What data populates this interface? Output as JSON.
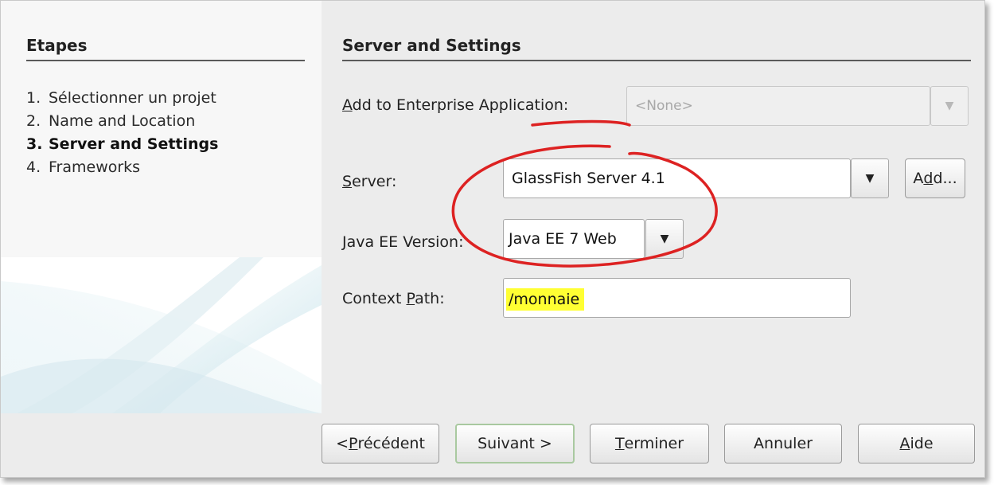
{
  "steps": {
    "title": "Etapes",
    "items": [
      {
        "num": "1.",
        "label": "Sélectionner un projet"
      },
      {
        "num": "2.",
        "label": "Name and Location"
      },
      {
        "num": "3.",
        "label": "Server and Settings"
      },
      {
        "num": "4.",
        "label": "Frameworks"
      }
    ],
    "current_index": 2
  },
  "panel": {
    "title": "Server and Settings",
    "enterprise": {
      "label_pre": "",
      "label_mn": "A",
      "label_post": "dd to Enterprise Application:",
      "value": "<None>",
      "enabled": false
    },
    "server": {
      "label_pre": "",
      "label_mn": "S",
      "label_post": "erver:",
      "value": "GlassFish Server 4.1",
      "add_pre": "A",
      "add_mn": "d",
      "add_post": "d..."
    },
    "java_ee": {
      "label_pre": "",
      "label_mn": "J",
      "label_post": "ava EE Version:",
      "value": "Java EE 7 Web"
    },
    "context": {
      "label_pre": "Context ",
      "label_mn": "P",
      "label_post": "ath:",
      "value": "/monnaie"
    }
  },
  "footer": {
    "prev": {
      "pre": "< ",
      "mn": "P",
      "post": "récédent"
    },
    "next": {
      "pre": "Suivant >",
      "mn": "",
      "post": ""
    },
    "finish": {
      "pre": "",
      "mn": "T",
      "post": "erminer"
    },
    "cancel": {
      "pre": "Annuler",
      "mn": "",
      "post": ""
    },
    "help": {
      "pre": "",
      "mn": "A",
      "post": "ide"
    }
  },
  "icons": {
    "dropdown": "dropdown-arrow-icon"
  },
  "colors": {
    "annotation": "#dd2222",
    "highlight": "#ffff33",
    "default_button_border": "#a9c9a0"
  }
}
